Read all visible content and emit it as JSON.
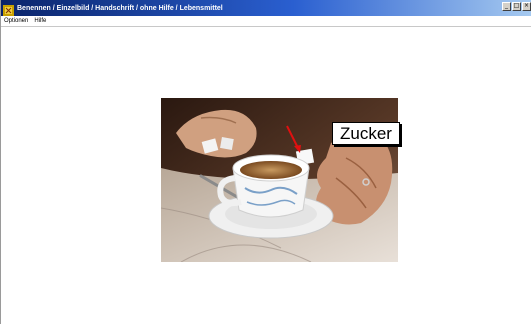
{
  "window": {
    "title": "Benennen / Einzelbild / Handschrift / ohne Hilfe / Lebensmittel"
  },
  "menu": {
    "items": [
      "Optionen",
      "Hilfe"
    ]
  },
  "picture": {
    "subject": "cup of coffee with sugar cube",
    "label": "Zucker",
    "arrow_color": "#e01010"
  },
  "colors": {
    "titlebar_start": "#0a246a",
    "titlebar_end": "#a6caf0"
  }
}
